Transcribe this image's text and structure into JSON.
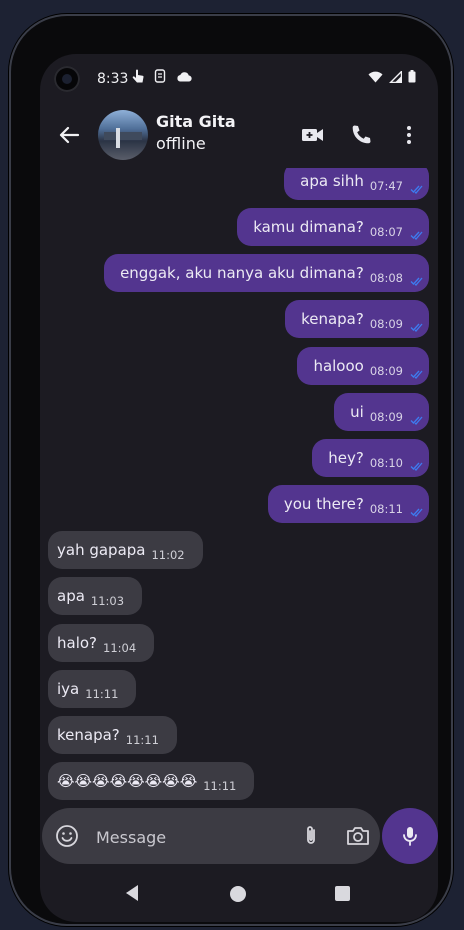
{
  "status_bar": {
    "time": "8:33"
  },
  "header": {
    "contact_name": "Gita Gita",
    "contact_status": "offline"
  },
  "messages": [
    {
      "dir": "out",
      "text": "apa sihh",
      "time": "07:47"
    },
    {
      "dir": "out",
      "text": "kamu dimana?",
      "time": "08:07"
    },
    {
      "dir": "out",
      "text": "enggak, aku nanya aku dimana?",
      "time": "08:08"
    },
    {
      "dir": "out",
      "text": "kenapa?",
      "time": "08:09"
    },
    {
      "dir": "out",
      "text": "halooo",
      "time": "08:09"
    },
    {
      "dir": "out",
      "text": "ui",
      "time": "08:09"
    },
    {
      "dir": "out",
      "text": "hey?",
      "time": "08:10"
    },
    {
      "dir": "out",
      "text": "you there?",
      "time": "08:11"
    },
    {
      "dir": "in",
      "text": "yah gapapa",
      "time": "11:02"
    },
    {
      "dir": "in",
      "text": "apa",
      "time": "11:03"
    },
    {
      "dir": "in",
      "text": "halo?",
      "time": "11:04"
    },
    {
      "dir": "in",
      "text": "iya",
      "time": "11:11"
    },
    {
      "dir": "in",
      "text": "kenapa?",
      "time": "11:11"
    },
    {
      "dir": "in",
      "text": "😭😭😭😭😭😭😭😭",
      "time": "11:11"
    }
  ],
  "composer": {
    "placeholder": "Message"
  },
  "icons": {
    "back": "arrow-back-icon",
    "video_call": "video-call-icon",
    "phone": "phone-icon",
    "more": "more-vert-icon",
    "emoji": "emoji-icon",
    "attach": "paperclip-icon",
    "camera": "camera-icon",
    "mic": "mic-icon"
  },
  "colors": {
    "outgoing_bubble": "#53358f",
    "incoming_bubble": "#3c3b43",
    "background": "#1c1b22",
    "read_check": "#3d7cf0"
  }
}
